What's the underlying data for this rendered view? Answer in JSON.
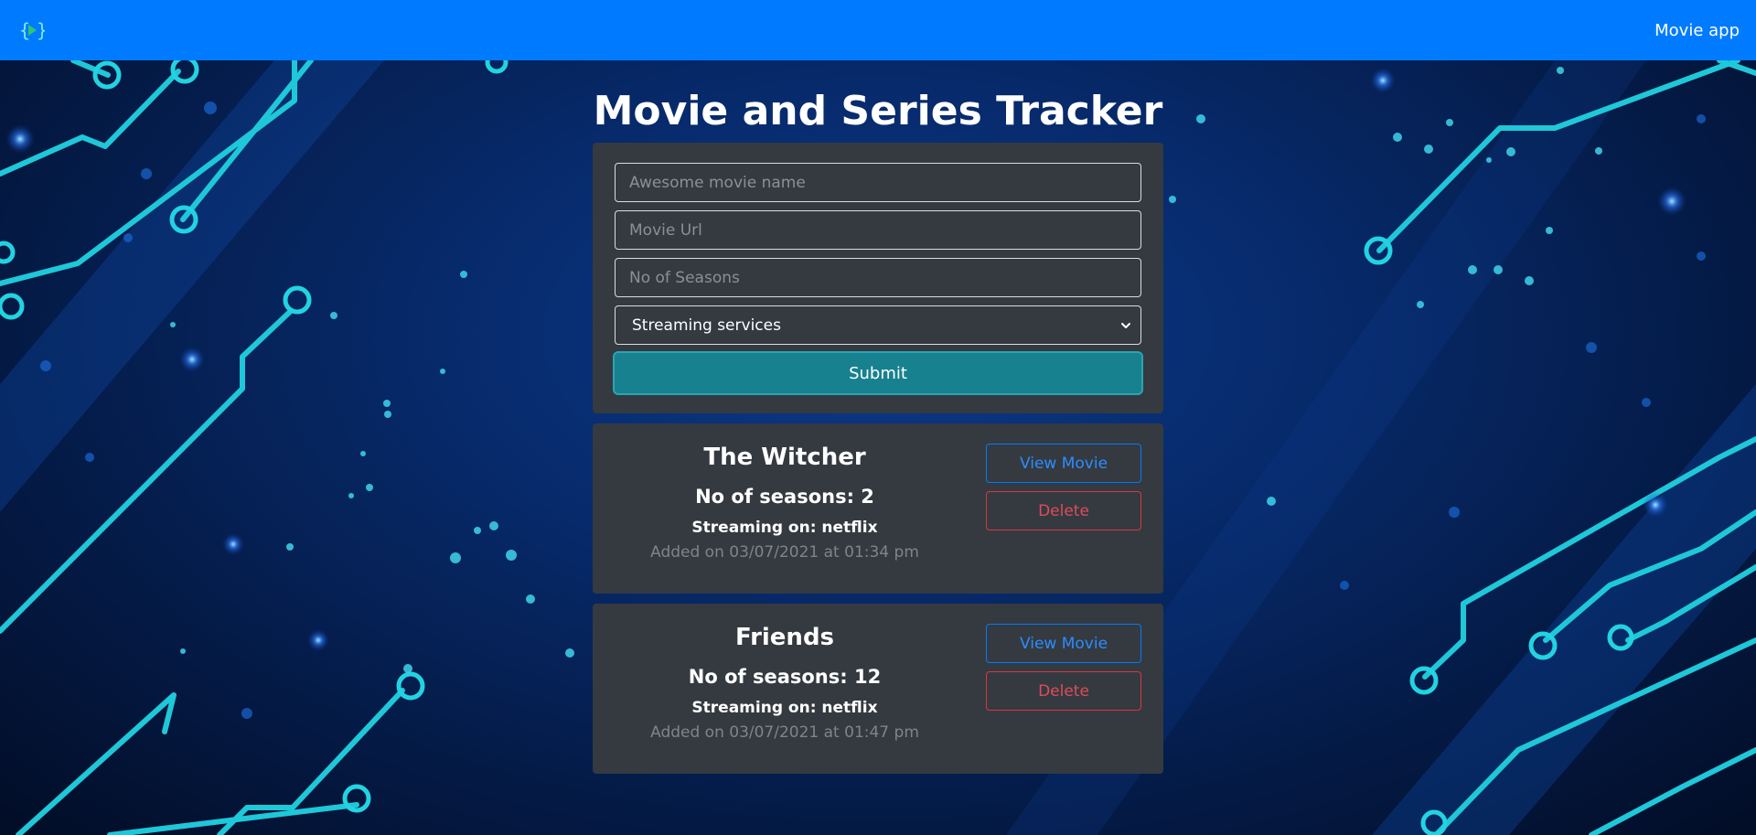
{
  "navbar": {
    "logo_icon": "brackets-play-icon",
    "title": "Movie app",
    "color": "#007bff"
  },
  "page": {
    "title": "Movie and Series Tracker"
  },
  "form": {
    "name_placeholder": "Awesome movie name",
    "url_placeholder": "Movie Url",
    "seasons_placeholder": "No of Seasons",
    "streaming_select_value": "Streaming services",
    "submit_label": "Submit"
  },
  "cards": [
    {
      "title": "The Witcher",
      "seasons_label": "No of seasons: 2",
      "streaming_label": "Streaming on: netflix",
      "added": "Added on 03/07/2021 at 01:34 pm",
      "view_label": "View Movie",
      "delete_label": "Delete"
    },
    {
      "title": "Friends",
      "seasons_label": "No of seasons: 12",
      "streaming_label": "Streaming on: netflix",
      "added": "Added on 03/07/2021 at 01:47 pm",
      "view_label": "View Movie",
      "delete_label": "Delete"
    }
  ],
  "colors": {
    "panel": "#343a40",
    "submit": "#17818f",
    "view_outline": "#007bff",
    "delete_outline": "#dc3545",
    "circuit": "#1ec8d8"
  }
}
